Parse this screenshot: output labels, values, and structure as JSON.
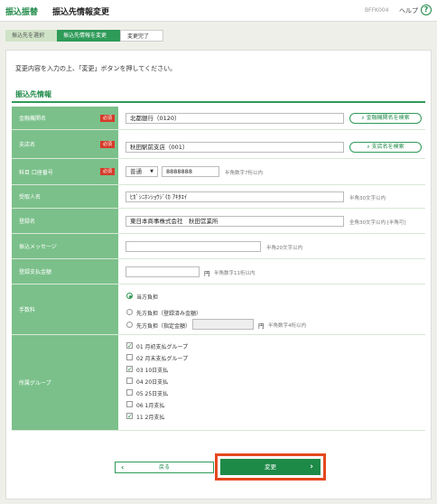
{
  "header": {
    "app_name": "振込振替",
    "page_title": "振込先情報変更",
    "screen_id": "BFFK004",
    "help_label": "ヘルプ",
    "help_icon": "?"
  },
  "steps": [
    "振込先を選択",
    "振込先情報を変更",
    "変更完了"
  ],
  "instruction": "変更内容を入力の上、「変更」ボタンを押してください。",
  "section_title": "振込先情報",
  "required_badge": "必須",
  "form": {
    "bank": {
      "label": "金融機関名",
      "value": "北都銀行（0120）",
      "search_button": "金融機関名を検索"
    },
    "branch": {
      "label": "支店名",
      "value": "秋田駅前支店（001）",
      "search_button": "支店名を検索"
    },
    "account": {
      "label": "科目 口座番号",
      "type_value": "普通",
      "number_value": "8888888",
      "hint": "半角数字7桁以内"
    },
    "recipient": {
      "label": "受取人名",
      "value": "ﾋｶﾞｼﾆﾎﾝｼｮｳｼﾞ(ｶ ｱｷﾀｴｲ",
      "hint": "半角30文字以内"
    },
    "registered_name": {
      "label": "登録名",
      "value": "東日本商事株式会社　秋田営業所",
      "hint": "全角30文字以内 [半角可]"
    },
    "message": {
      "label": "振込メッセージ",
      "value": "",
      "hint": "半角20文字以内"
    },
    "payment_amount": {
      "label": "登録支払金額",
      "value": "",
      "unit": "円",
      "hint": "半角数字11桁以内"
    },
    "fee": {
      "label": "手数料",
      "options": [
        {
          "text": "当方負担",
          "selected": true
        },
        {
          "text": "先方負担（登録済み金額）",
          "selected": false
        },
        {
          "text": "先方負担（指定金額）",
          "selected": false
        }
      ],
      "amount_unit": "円",
      "amount_hint": "半角数字4桁以内"
    },
    "groups": {
      "label": "所属グループ",
      "items": [
        {
          "text": "01 月初支払グループ",
          "checked": true
        },
        {
          "text": "02 月末支払グループ",
          "checked": false
        },
        {
          "text": "03 10日支払",
          "checked": true
        },
        {
          "text": "04 20日支払",
          "checked": false
        },
        {
          "text": "05 25日支払",
          "checked": false
        },
        {
          "text": "06 1月支払",
          "checked": false
        },
        {
          "text": "11 2月支払",
          "checked": true
        }
      ]
    }
  },
  "buttons": {
    "back": "戻る",
    "submit": "変更"
  },
  "colors": {
    "brand": "#1e8a48",
    "label_bg": "#7bc08a",
    "required": "#d63b2a",
    "highlight": "#e5481f"
  }
}
